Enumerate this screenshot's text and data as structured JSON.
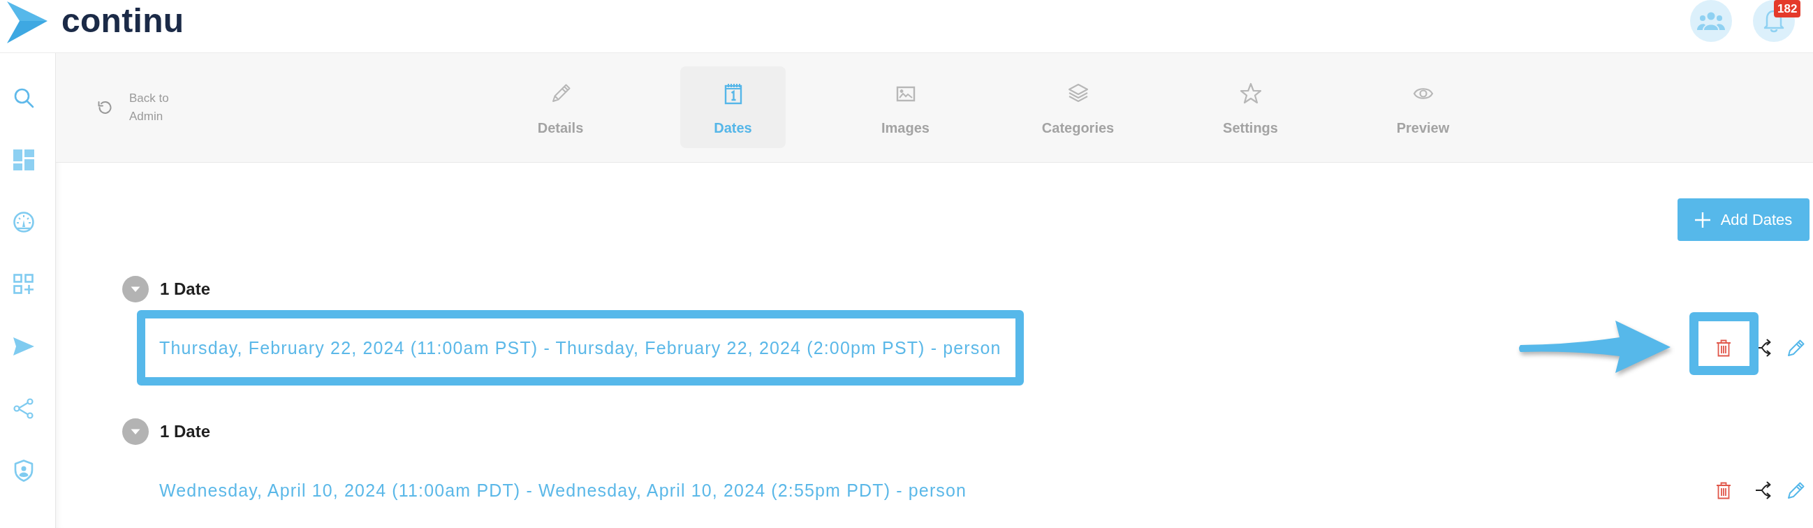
{
  "brand": {
    "name": "continu"
  },
  "top_bar": {
    "notification_count": "182"
  },
  "back_link": {
    "label": "Back to Admin"
  },
  "tabs": [
    {
      "label": "Details",
      "selected": false
    },
    {
      "label": "Dates",
      "selected": true
    },
    {
      "label": "Images",
      "selected": false
    },
    {
      "label": "Categories",
      "selected": false
    },
    {
      "label": "Settings",
      "selected": false
    },
    {
      "label": "Preview",
      "selected": false
    }
  ],
  "add_button": {
    "label": "Add Dates"
  },
  "groups": [
    {
      "title": "1 Date",
      "expanded": true,
      "dates": [
        {
          "text": "Thursday, February 22, 2024 (11:00am PST) - Thursday, February 22, 2024 (2:00pm PST) - person",
          "highlighted": true,
          "delete_highlighted": true
        }
      ]
    },
    {
      "title": "1 Date",
      "expanded": true,
      "dates": [
        {
          "text": "Wednesday, April 10, 2024 (11:00am PDT) - Wednesday, April 10, 2024 (2:55pm PDT) - person",
          "highlighted": false,
          "delete_highlighted": false
        }
      ]
    }
  ]
}
